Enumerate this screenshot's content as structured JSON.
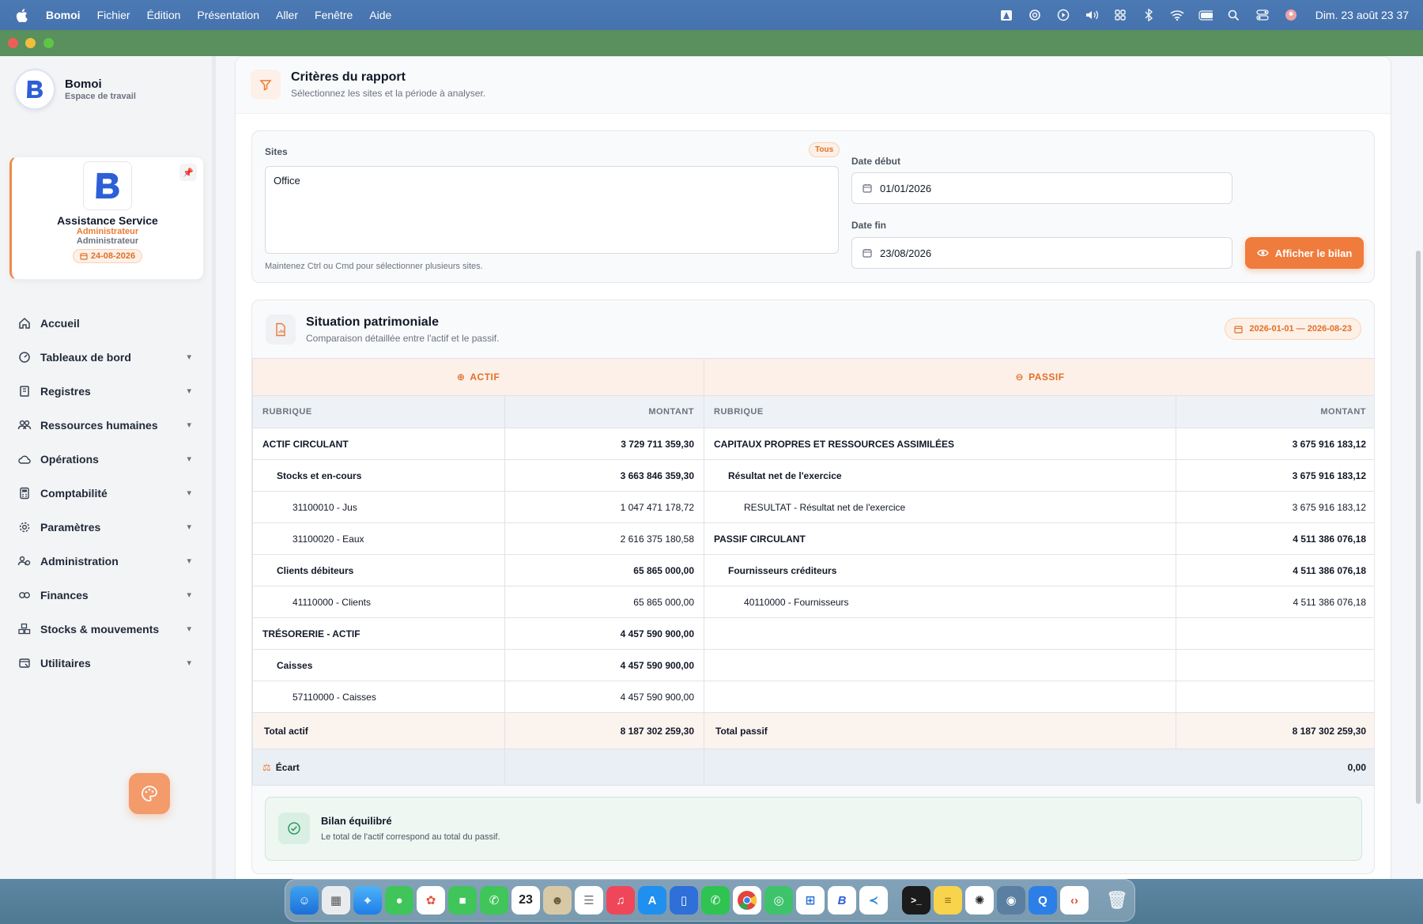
{
  "menubar": {
    "app_name": "Bomoi",
    "menus": [
      "Fichier",
      "Édition",
      "Présentation",
      "Aller",
      "Fenêtre",
      "Aide"
    ],
    "clock": "Dim. 23 août  23 37"
  },
  "sidebar": {
    "brand_name": "Bomoi",
    "brand_sub": "Espace de travail",
    "user": {
      "name": "Assistance Service",
      "role": "Administrateur",
      "role_secondary": "Administrateur",
      "date": "24-08-2026"
    },
    "nav": [
      {
        "label": "Accueil",
        "icon": "home-icon",
        "expandable": false
      },
      {
        "label": "Tableaux de bord",
        "icon": "gauge-icon",
        "expandable": true
      },
      {
        "label": "Registres",
        "icon": "book-icon",
        "expandable": true
      },
      {
        "label": "Ressources humaines",
        "icon": "users-icon",
        "expandable": true
      },
      {
        "label": "Opérations",
        "icon": "cloud-icon",
        "expandable": true
      },
      {
        "label": "Comptabilité",
        "icon": "calculator-icon",
        "expandable": true
      },
      {
        "label": "Paramètres",
        "icon": "gear-icon",
        "expandable": true
      },
      {
        "label": "Administration",
        "icon": "users-cog-icon",
        "expandable": true
      },
      {
        "label": "Finances",
        "icon": "coins-icon",
        "expandable": true
      },
      {
        "label": "Stocks & mouvements",
        "icon": "boxes-icon",
        "expandable": true
      },
      {
        "label": "Utilitaires",
        "icon": "tools-icon",
        "expandable": true
      }
    ]
  },
  "criteria": {
    "title": "Critères du rapport",
    "subtitle": "Sélectionnez les sites et la période à analyser.",
    "sites_label": "Sites",
    "tous_badge": "Tous",
    "sites_selected": "Office",
    "sites_hint": "Maintenez Ctrl ou Cmd pour sélectionner plusieurs sites.",
    "date_start_label": "Date début",
    "date_start": "01/01/2026",
    "date_end_label": "Date fin",
    "date_end": "23/08/2026",
    "submit_label": "Afficher le bilan"
  },
  "report": {
    "title": "Situation patrimoniale",
    "subtitle": "Comparaison détaillée entre l'actif et le passif.",
    "period": "2026-01-01 — 2026-08-23",
    "actif_header": "ACTIF",
    "passif_header": "PASSIF",
    "col_rubrique": "RUBRIQUE",
    "col_montant": "MONTANT",
    "rows": [
      {
        "a_label": "ACTIF CIRCULANT",
        "a_value": "3 729 711 359,30",
        "a_level": 0,
        "p_label": "CAPITAUX PROPRES ET RESSOURCES ASSIMILÉES",
        "p_value": "3 675 916 183,12",
        "p_level": 0
      },
      {
        "a_label": "Stocks et en-cours",
        "a_value": "3 663 846 359,30",
        "a_level": 1,
        "p_label": "Résultat net de l'exercice",
        "p_value": "3 675 916 183,12",
        "p_level": 1
      },
      {
        "a_label": "31100010 - Jus",
        "a_value": "1 047 471 178,72",
        "a_level": 2,
        "p_label": "RESULTAT - Résultat net de l'exercice",
        "p_value": "3 675 916 183,12",
        "p_level": 2
      },
      {
        "a_label": "31100020 - Eaux",
        "a_value": "2 616 375 180,58",
        "a_level": 2,
        "p_label": "PASSIF CIRCULANT",
        "p_value": "4 511 386 076,18",
        "p_level": 0
      },
      {
        "a_label": "Clients débiteurs",
        "a_value": "65 865 000,00",
        "a_level": 1,
        "p_label": "Fournisseurs créditeurs",
        "p_value": "4 511 386 076,18",
        "p_level": 1
      },
      {
        "a_label": "41110000 - Clients",
        "a_value": "65 865 000,00",
        "a_level": 2,
        "p_label": "40110000 - Fournisseurs",
        "p_value": "4 511 386 076,18",
        "p_level": 2
      },
      {
        "a_label": "TRÉSORERIE - ACTIF",
        "a_value": "4 457 590 900,00",
        "a_level": 0,
        "p_label": "",
        "p_value": "",
        "p_level": 2
      },
      {
        "a_label": "Caisses",
        "a_value": "4 457 590 900,00",
        "a_level": 1,
        "p_label": "",
        "p_value": "",
        "p_level": 2
      },
      {
        "a_label": "57110000 - Caisses",
        "a_value": "4 457 590 900,00",
        "a_level": 2,
        "p_label": "",
        "p_value": "",
        "p_level": 2
      }
    ],
    "total_actif_label": "Total actif",
    "total_actif": "8 187 302 259,30",
    "total_passif_label": "Total passif",
    "total_passif": "8 187 302 259,30",
    "ecart_label": "Écart",
    "ecart_value": "0,00",
    "status_title": "Bilan équilibré",
    "status_sub": "Le total de l'actif correspond au total du passif."
  },
  "dock": {
    "calendar_day": "23",
    "apps": [
      "finder-icon",
      "launchpad-icon",
      "safari-icon",
      "messages-icon",
      "photos-icon",
      "facetime-icon",
      "phone-icon",
      "calendar-icon",
      "contacts-icon",
      "reminders-icon",
      "music-icon",
      "appstore-icon",
      "simulator-icon",
      "whatsapp-icon",
      "chrome-icon",
      "find-my-icon",
      "windows-app-icon",
      "bomoi-icon",
      "vscode-icon",
      "terminal-icon",
      "notes-icon",
      "chatgpt-icon",
      "disk-utility-icon",
      "quicktime-icon",
      "script-editor-icon",
      "trash-icon"
    ]
  },
  "colors": {
    "accent": "#ef7b3c",
    "titlebar": "#5a8f5e",
    "success": "#2f9963"
  }
}
